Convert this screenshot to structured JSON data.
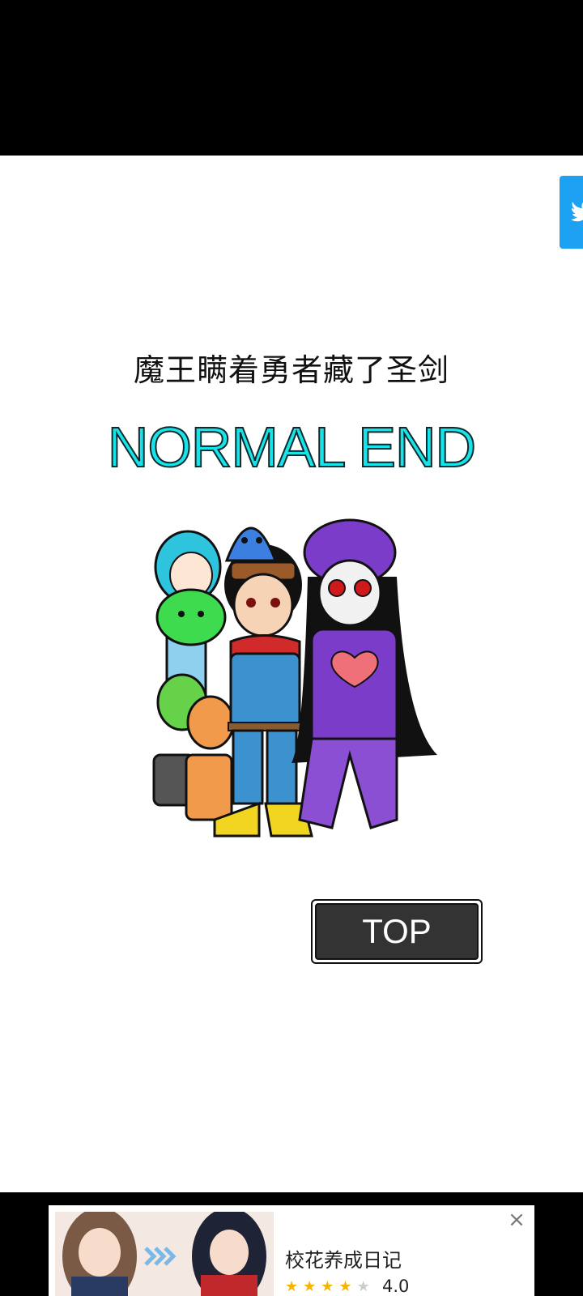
{
  "ending": {
    "subtitle": "魔王瞒着勇者藏了圣剑",
    "title": "NORMAL END"
  },
  "buttons": {
    "top_label": "TOP"
  },
  "share": {
    "icon": "twitter-bird-icon",
    "color": "#1da1f2"
  },
  "ad": {
    "title": "校花养成日记",
    "rating": "4.0",
    "stars_filled": 4,
    "stars_total": 5,
    "close_icon": "close-icon"
  },
  "colors": {
    "end_title": "#19e3ea",
    "button_bg": "#333333"
  }
}
